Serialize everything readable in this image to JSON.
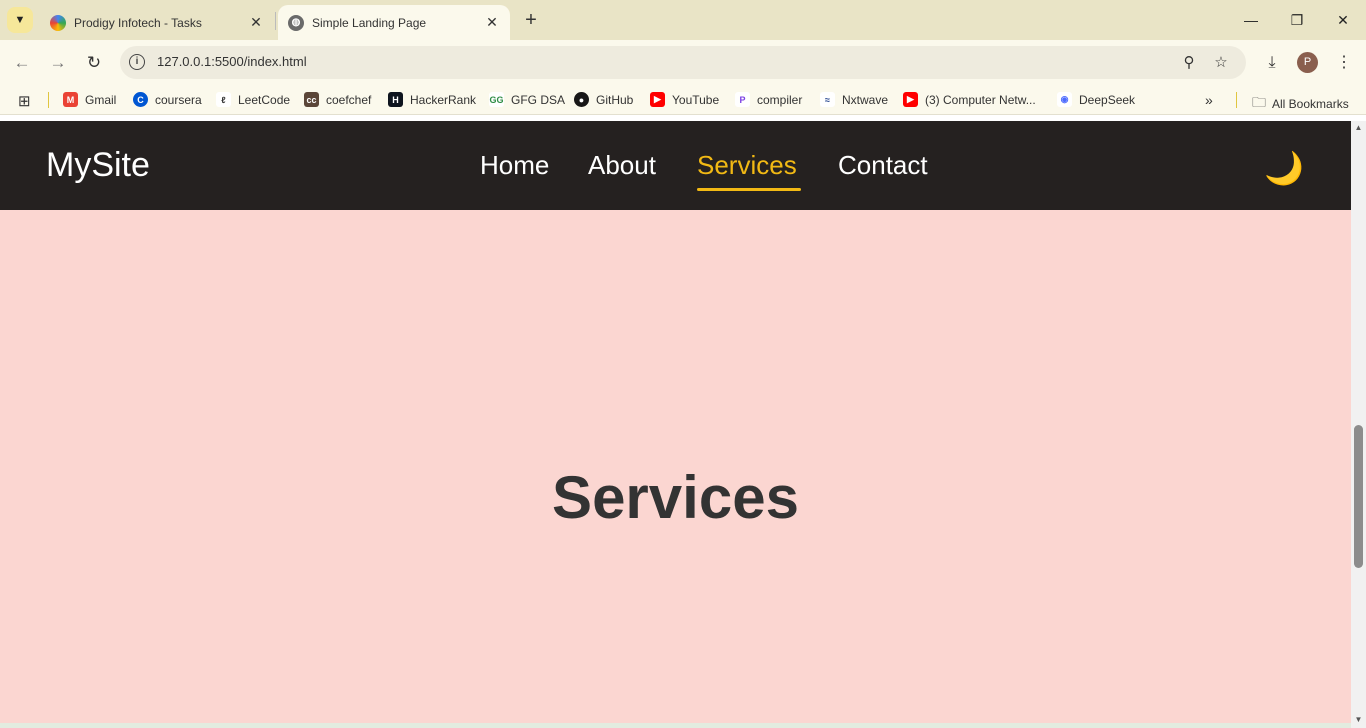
{
  "browser": {
    "tabs": [
      {
        "title": "Prodigy Infotech - Tasks",
        "favicon": "prodigy-favicon",
        "active": false
      },
      {
        "title": "Simple Landing Page",
        "favicon": "globe-icon",
        "active": true
      }
    ],
    "new_tab_symbol": "+",
    "url": "127.0.0.1:5500/index.html",
    "bookmarks": [
      {
        "label": "Gmail",
        "icon": "gmail-icon",
        "color": "#ea4335"
      },
      {
        "label": "coursera",
        "icon": "coursera-icon",
        "color": "#0056d2"
      },
      {
        "label": "LeetCode",
        "icon": "leetcode-icon",
        "color": "#ffa116"
      },
      {
        "label": "coefchef",
        "icon": "codechef-icon",
        "color": "#5b4638"
      },
      {
        "label": "HackerRank",
        "icon": "hackerrank-icon",
        "color": "#0e141e"
      },
      {
        "label": "GFG DSA",
        "icon": "gfg-icon",
        "color": "#2f8d46"
      },
      {
        "label": "GitHub",
        "icon": "github-icon",
        "color": "#181717"
      },
      {
        "label": "YouTube",
        "icon": "youtube-icon",
        "color": "#ff0000"
      },
      {
        "label": "compiler",
        "icon": "compiler-icon",
        "color": "#7b3fe4"
      },
      {
        "label": "Nxtwave",
        "icon": "nxtwave-icon",
        "color": "#1c3d8a"
      },
      {
        "label": "(3) Computer Netw...",
        "icon": "youtube-icon",
        "color": "#ff0000"
      },
      {
        "label": "DeepSeek",
        "icon": "deepseek-icon",
        "color": "#4d6bfe"
      }
    ],
    "all_bookmarks_label": "All Bookmarks",
    "profile_initial": "P"
  },
  "site": {
    "logo": "MySite",
    "nav": [
      "Home",
      "About",
      "Services",
      "Contact"
    ],
    "active_nav": "Services",
    "theme_toggle_icon": "🌙",
    "section_title": "Services",
    "colors": {
      "header_bg": "#252120",
      "accent": "#f2b914",
      "page_bg": "#fbd6d1",
      "title_text": "#333333"
    }
  }
}
